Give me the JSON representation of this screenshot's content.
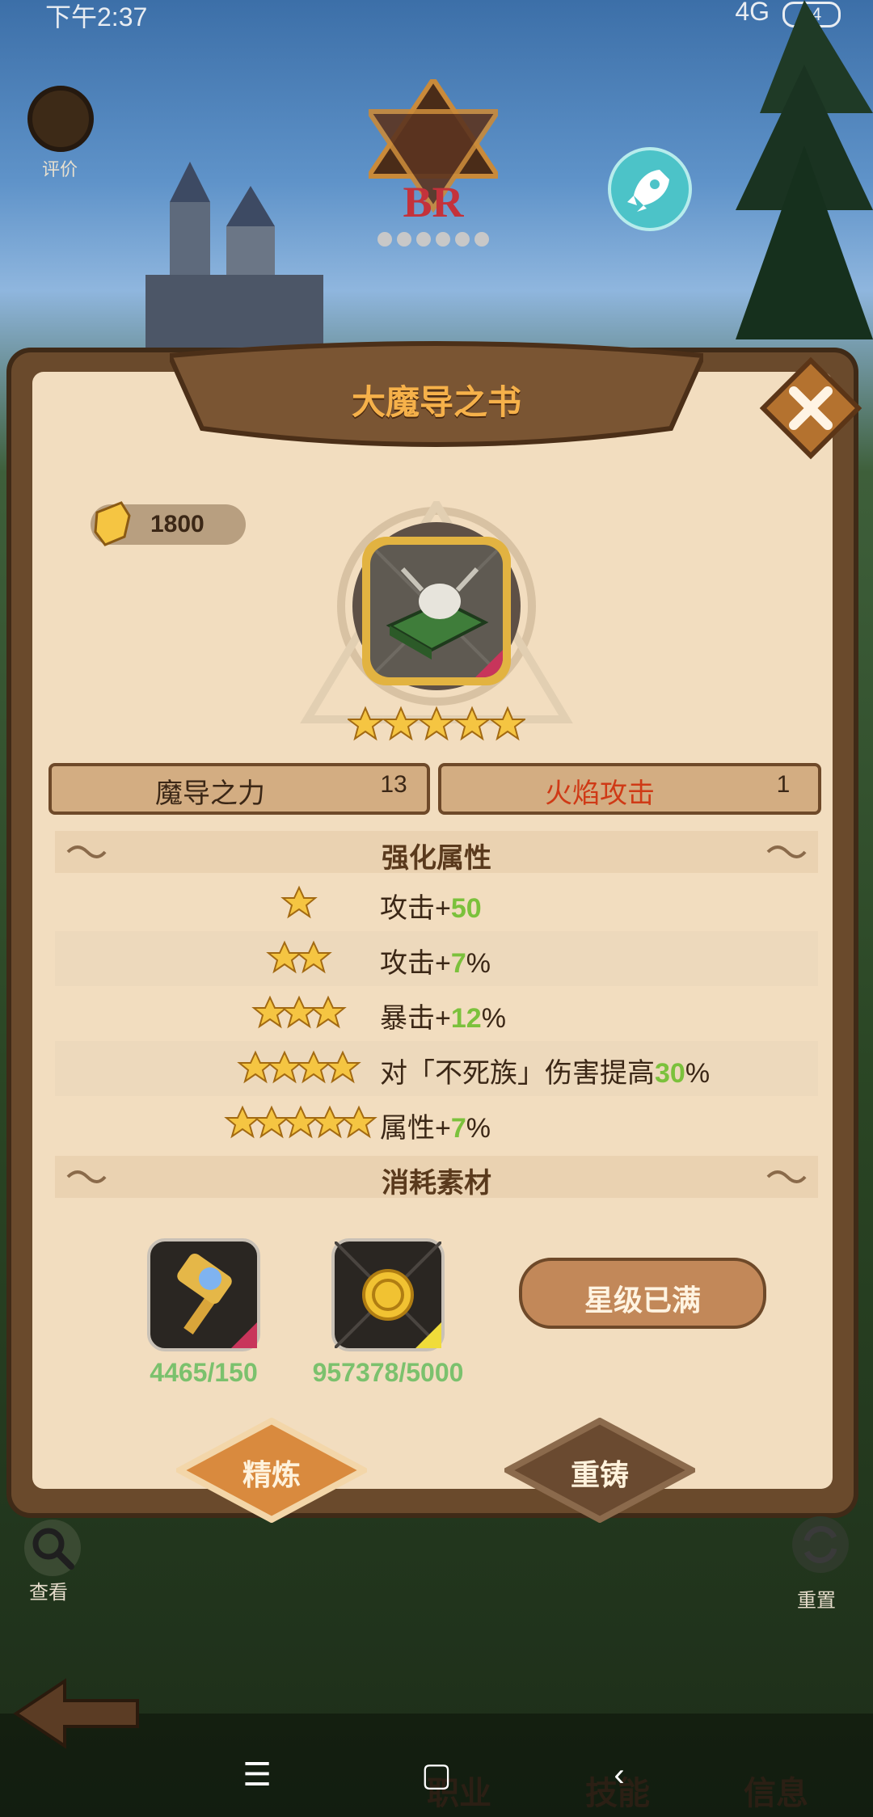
{
  "status_bar": {
    "time": "下午2:37",
    "network": "4G",
    "battery": "34"
  },
  "top": {
    "rating_label": "评价",
    "rank_label": "BR"
  },
  "item": {
    "title": "大魔导之书",
    "power": "1800",
    "stars": 5,
    "attributes": [
      {
        "name": "魔导之力",
        "value": "13"
      },
      {
        "name": "火焰攻击",
        "value": "1"
      }
    ]
  },
  "enhance": {
    "section_title": "强化属性",
    "rows": [
      {
        "stars": 1,
        "label": "攻击+",
        "value": "50",
        "suffix": ""
      },
      {
        "stars": 2,
        "label": "攻击+",
        "value": "7",
        "suffix": "%"
      },
      {
        "stars": 3,
        "label": "暴击+",
        "value": "12",
        "suffix": "%"
      },
      {
        "stars": 4,
        "label": "对「不死族」伤害提高",
        "value": "30",
        "suffix": "%"
      },
      {
        "stars": 5,
        "label": "属性+",
        "value": "7",
        "suffix": "%"
      }
    ]
  },
  "materials": {
    "section_title": "消耗素材",
    "items": [
      {
        "icon": "hammer-icon",
        "count": "4465/150"
      },
      {
        "icon": "coin-icon",
        "count": "957378/5000"
      }
    ],
    "max_star_label": "星级已满"
  },
  "tabs": {
    "refine": "精炼",
    "recast": "重铸"
  },
  "side": {
    "view": "查看",
    "reset": "重置"
  },
  "bottom_nav": {
    "job": "职业",
    "skill": "技能",
    "info": "信息"
  },
  "system_nav": {
    "menu": "☰",
    "home": "▢",
    "back": "‹"
  },
  "colors": {
    "accent": "#f6b14a",
    "highlight": "#7bc13c",
    "fire": "#cf3a16"
  }
}
